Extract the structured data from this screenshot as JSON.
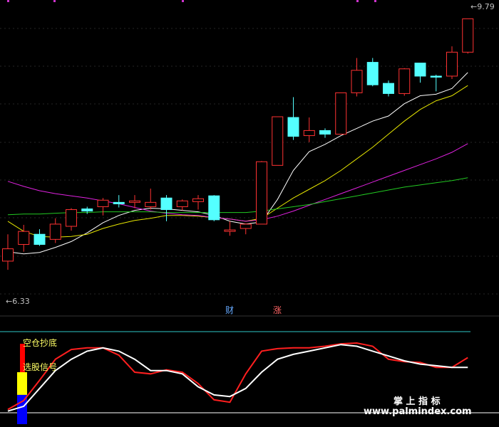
{
  "chart_data": [
    {
      "type": "candlestick",
      "ylim": [
        5.9,
        10.0
      ],
      "price_labels": {
        "low": "6.33",
        "high": "9.79"
      },
      "candles": [
        {
          "o": 6.45,
          "c": 6.62,
          "h": 6.82,
          "l": 6.33
        },
        {
          "o": 6.68,
          "c": 6.86,
          "h": 6.95,
          "l": 6.58
        },
        {
          "o": 6.82,
          "c": 6.68,
          "h": 6.89,
          "l": 6.66
        },
        {
          "o": 6.75,
          "c": 6.96,
          "h": 7.04,
          "l": 6.7
        },
        {
          "o": 6.93,
          "c": 7.16,
          "h": 7.18,
          "l": 6.87
        },
        {
          "o": 7.17,
          "c": 7.14,
          "h": 7.2,
          "l": 7.1
        },
        {
          "o": 7.2,
          "c": 7.29,
          "h": 7.32,
          "l": 7.08
        },
        {
          "o": 7.26,
          "c": 7.24,
          "h": 7.36,
          "l": 7.19
        },
        {
          "o": 7.26,
          "c": 7.28,
          "h": 7.36,
          "l": 7.18
        },
        {
          "o": 7.2,
          "c": 7.26,
          "h": 7.45,
          "l": 7.16
        },
        {
          "o": 7.32,
          "c": 7.16,
          "h": 7.36,
          "l": 7.0
        },
        {
          "o": 7.2,
          "c": 7.28,
          "h": 7.3,
          "l": 7.15
        },
        {
          "o": 7.27,
          "c": 7.31,
          "h": 7.36,
          "l": 7.16
        },
        {
          "o": 7.35,
          "c": 7.02,
          "h": 7.36,
          "l": 7.0
        },
        {
          "o": 6.86,
          "c": 6.88,
          "h": 7.0,
          "l": 6.8
        },
        {
          "o": 6.9,
          "c": 6.96,
          "h": 6.97,
          "l": 6.82
        },
        {
          "o": 6.96,
          "c": 7.82,
          "h": 7.83,
          "l": 6.96
        },
        {
          "o": 7.77,
          "c": 8.44,
          "h": 8.44,
          "l": 7.77
        },
        {
          "o": 8.43,
          "c": 8.17,
          "h": 8.71,
          "l": 8.12
        },
        {
          "o": 8.18,
          "c": 8.25,
          "h": 8.43,
          "l": 8.09
        },
        {
          "o": 8.25,
          "c": 8.2,
          "h": 8.28,
          "l": 8.15
        },
        {
          "o": 8.2,
          "c": 8.77,
          "h": 8.77,
          "l": 8.2
        },
        {
          "o": 8.77,
          "c": 9.08,
          "h": 9.25,
          "l": 8.72
        },
        {
          "o": 9.19,
          "c": 8.88,
          "h": 9.25,
          "l": 8.86
        },
        {
          "o": 8.9,
          "c": 8.76,
          "h": 8.94,
          "l": 8.72
        },
        {
          "o": 8.76,
          "c": 9.1,
          "h": 9.11,
          "l": 8.73
        },
        {
          "o": 9.18,
          "c": 9.0,
          "h": 9.18,
          "l": 8.91
        },
        {
          "o": 9.0,
          "c": 8.99,
          "h": 9.02,
          "l": 8.79
        },
        {
          "o": 9.0,
          "c": 9.33,
          "h": 9.41,
          "l": 8.96
        },
        {
          "o": 9.33,
          "c": 9.79,
          "h": 9.79,
          "l": 9.31
        }
      ],
      "ma_lines": [
        {
          "color": "#ffffff",
          "values": [
            6.58,
            6.55,
            6.57,
            6.64,
            6.72,
            6.84,
            6.98,
            7.08,
            7.15,
            7.18,
            7.17,
            7.15,
            7.13,
            7.08,
            7.0,
            6.96,
            6.99,
            7.3,
            7.7,
            7.96,
            8.06,
            8.18,
            8.28,
            8.38,
            8.45,
            8.62,
            8.73,
            8.75,
            8.83,
            9.05
          ]
        },
        {
          "color": "#e6e600",
          "values": [
            7.0,
            6.86,
            6.79,
            6.78,
            6.79,
            6.82,
            6.9,
            6.96,
            7.01,
            7.04,
            7.08,
            7.08,
            7.07,
            7.05,
            7.03,
            7.0,
            7.04,
            7.18,
            7.32,
            7.44,
            7.56,
            7.7,
            7.86,
            8.02,
            8.2,
            8.38,
            8.54,
            8.66,
            8.73,
            8.87
          ]
        },
        {
          "color": "#e022e0",
          "values": [
            7.55,
            7.48,
            7.42,
            7.38,
            7.35,
            7.32,
            7.28,
            7.24,
            7.19,
            7.14,
            7.11,
            7.09,
            7.08,
            7.05,
            7.03,
            7.0,
            7.02,
            7.07,
            7.14,
            7.22,
            7.3,
            7.38,
            7.46,
            7.54,
            7.62,
            7.7,
            7.78,
            7.86,
            7.95,
            8.07
          ]
        },
        {
          "color": "#22c922",
          "values": [
            7.09,
            7.1,
            7.1,
            7.11,
            7.12,
            7.12,
            7.13,
            7.13,
            7.13,
            7.13,
            7.12,
            7.12,
            7.12,
            7.12,
            7.12,
            7.12,
            7.14,
            7.17,
            7.2,
            7.23,
            7.27,
            7.31,
            7.35,
            7.39,
            7.43,
            7.47,
            7.5,
            7.53,
            7.56,
            7.6
          ]
        }
      ],
      "markers": [
        "财",
        "涨"
      ]
    },
    {
      "type": "line",
      "ylim": [
        0,
        100
      ],
      "labels": [
        "空仓抄底",
        "选股信号"
      ],
      "series": [
        {
          "color": "#ff1f1f",
          "values": [
            4,
            15,
            40,
            66,
            78,
            80,
            80,
            71,
            50,
            48,
            53,
            50,
            36,
            16,
            13,
            48,
            76,
            79,
            80,
            80,
            82,
            85,
            86,
            82,
            66,
            63,
            62,
            56,
            56,
            68
          ]
        },
        {
          "color": "#ffffff",
          "values": [
            2,
            8,
            30,
            52,
            66,
            76,
            80,
            76,
            66,
            52,
            52,
            48,
            32,
            22,
            20,
            30,
            50,
            66,
            72,
            76,
            80,
            84,
            82,
            76,
            70,
            64,
            60,
            58,
            56,
            56
          ]
        }
      ],
      "bars": [
        {
          "color": "#ff0000",
          "values": [
            85
          ]
        },
        {
          "color": "#ffff00",
          "values": [
            50
          ]
        },
        {
          "color": "#0000ff",
          "values": [
            22
          ]
        }
      ]
    }
  ],
  "watermark": {
    "title": "掌 上 指 标",
    "url": "www.palmindex.com"
  }
}
